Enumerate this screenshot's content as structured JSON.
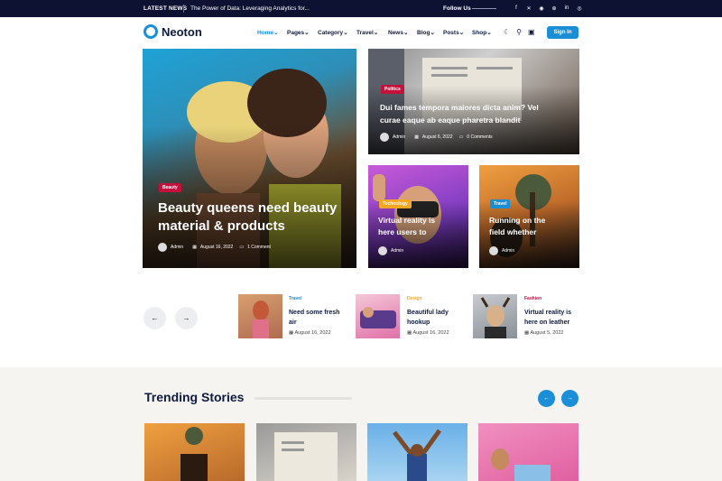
{
  "topbar": {
    "latest_label": "LATEST NEWS",
    "ticker": "The Power of Data: Leveraging Analytics for...",
    "follow_label": "Follow Us",
    "social_icons": [
      "facebook-icon",
      "x-icon",
      "rss-icon",
      "dribbble-icon",
      "linkedin-icon",
      "instagram-icon"
    ]
  },
  "header": {
    "logo_text": "Neoton",
    "nav": [
      {
        "label": "Home",
        "active": true
      },
      {
        "label": "Pages"
      },
      {
        "label": "Category"
      },
      {
        "label": "Travel"
      },
      {
        "label": "News"
      },
      {
        "label": "Blog"
      },
      {
        "label": "Posts"
      },
      {
        "label": "Shop"
      }
    ],
    "signin_label": "Sign In"
  },
  "hero": {
    "main": {
      "category": "Beauty",
      "title_line1": "Beauty queens need beauty",
      "title_line2": "material & products",
      "author": "Admin",
      "date": "August 16, 2022",
      "comments": "1 Comment"
    },
    "top_right": {
      "category": "Politics",
      "title_line1": "Dui fames tempora maiores dicta anim? Vel",
      "title_line2": "curae eaque ab eaque pharetra blandit",
      "author": "Admin",
      "date": "August 6, 2022",
      "comments": "0 Comments"
    },
    "small_left": {
      "category": "Technology",
      "title_line1": "Virtual reality is",
      "title_line2": "here users to",
      "author": "Admin"
    },
    "small_right": {
      "category": "Travel",
      "title_line1": "Running on the",
      "title_line2": "field whether",
      "author": "Admin"
    }
  },
  "carousel": {
    "items": [
      {
        "category": "Travel",
        "title_line1": "Need some fresh",
        "title_line2": "air",
        "date": "August 16, 2022"
      },
      {
        "category": "Design",
        "title_line1": "Beautiful lady",
        "title_line2": "hookup",
        "date": "August 16, 2022"
      },
      {
        "category": "Fashion",
        "title_line1": "Virtual reality is",
        "title_line2": "here on leather",
        "date": "August 5, 2022"
      }
    ]
  },
  "trending": {
    "title": "Trending Stories"
  },
  "colors": {
    "accent": "#1a8ed6",
    "badge_red": "#c5103c",
    "badge_orange": "#f5a623",
    "badge_blue": "#1a8ed6",
    "dark_navy": "#0d1233"
  }
}
